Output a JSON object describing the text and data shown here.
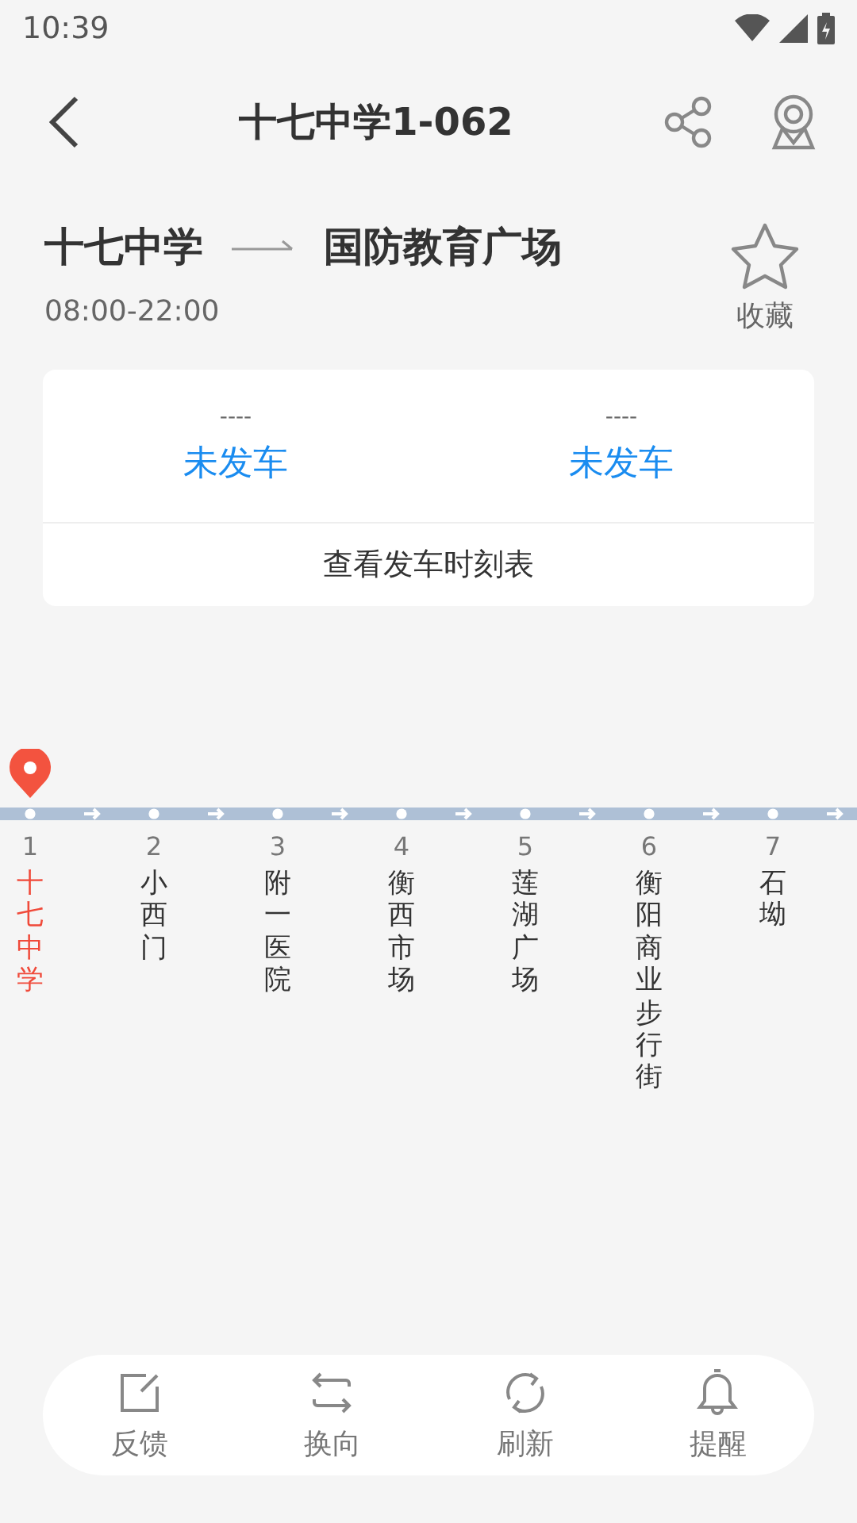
{
  "status_bar": {
    "time": "10:39"
  },
  "header": {
    "title": "十七中学1-062"
  },
  "route": {
    "from": "十七中学",
    "to": "国防教育广场",
    "hours": "08:00-22:00",
    "favorite": {
      "label": "收藏",
      "selected": false
    }
  },
  "departures": [
    {
      "time": "----",
      "status": "未发车"
    },
    {
      "time": "----",
      "status": "未发车"
    }
  ],
  "timetable_link": "查看发车时刻表",
  "stations": [
    {
      "number": "1",
      "name": "十七中学",
      "selected": true
    },
    {
      "number": "2",
      "name": "小西门",
      "selected": false
    },
    {
      "number": "3",
      "name": "附一医院",
      "selected": false
    },
    {
      "number": "4",
      "name": "衡西市场",
      "selected": false
    },
    {
      "number": "5",
      "name": "莲湖广场",
      "selected": false
    },
    {
      "number": "6",
      "name": "衡阳商业步行街",
      "selected": false
    },
    {
      "number": "7",
      "name": "石坳",
      "selected": false
    }
  ],
  "toolbar": [
    {
      "kind": "feedback",
      "label": "反馈"
    },
    {
      "kind": "reverse",
      "label": "换向"
    },
    {
      "kind": "refresh",
      "label": "刷新"
    },
    {
      "kind": "remind",
      "label": "提醒"
    }
  ]
}
